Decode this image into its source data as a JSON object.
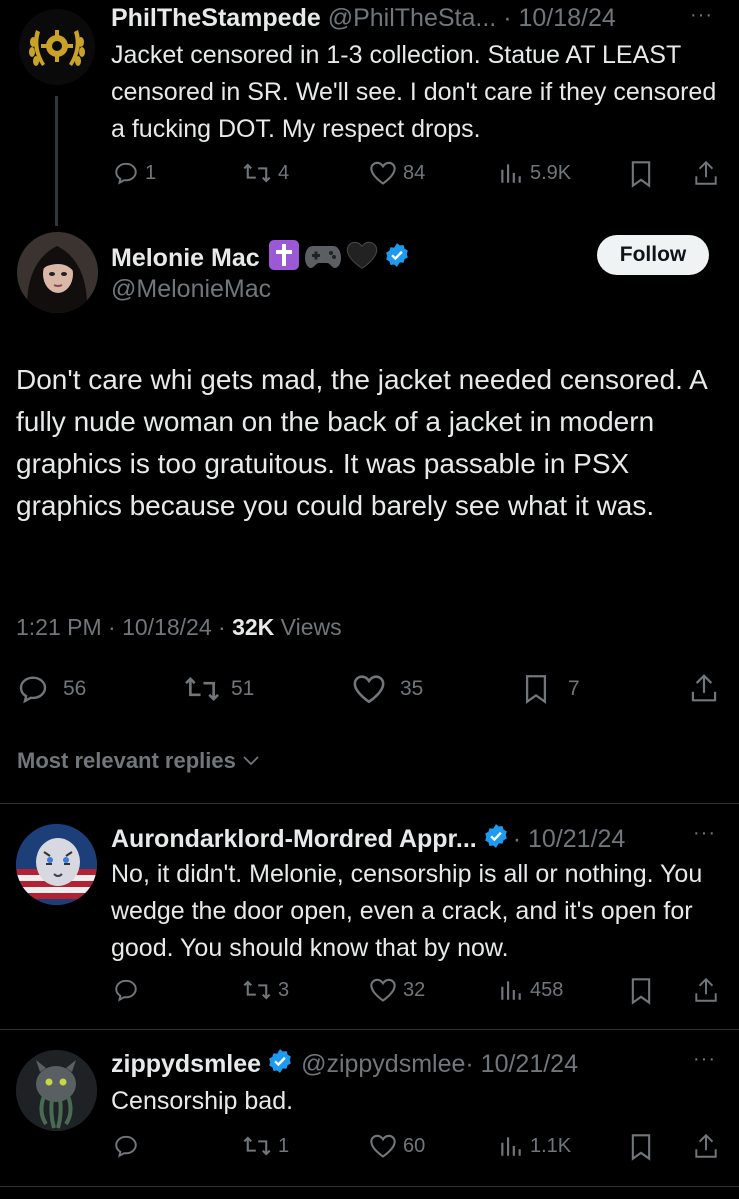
{
  "tweet1": {
    "display_name": "PhilTheStampede",
    "handle": "@PhilTheSta...",
    "date": "· 10/18/24",
    "more": "···",
    "text": "Jacket censored in 1-3 collection. Statue AT LEAST censored in SR. We'll see. I don't care if they censored a fucking DOT. My respect drops.",
    "replies": "1",
    "retweets": "4",
    "likes": "84",
    "views": "5.9K"
  },
  "main": {
    "display_name": "Melonie Mac",
    "emojis": [
      "cross-emoji",
      "gamepad-emoji",
      "black-heart-emoji"
    ],
    "handle": "@MelonieMac",
    "follow_label": "Follow",
    "text": "Don't care whi gets mad, the jacket needed censored. A fully nude woman on the back of a jacket in modern graphics is too gratuitous. It was passable in PSX graphics because you could barely see what it was.",
    "time": "1:21 PM · 10/18/24 · ",
    "views_count": "32K",
    "views_label": " Views",
    "replies": "56",
    "retweets": "51",
    "likes": "35",
    "bookmarks": "7"
  },
  "sort": {
    "label": "Most relevant replies"
  },
  "reply1": {
    "display_name": "Aurondarklord-Mordred Appr...",
    "date": "· 10/21/24",
    "more": "···",
    "text": "No, it didn't.  Melonie, censorship is all or nothing. You wedge the door open, even a crack, and it's open for good.  You should know that by now.",
    "replies": "",
    "retweets": "3",
    "likes": "32",
    "views": "458"
  },
  "reply2": {
    "display_name": "zippydsmlee",
    "handle": "@zippydsmlee",
    "date": "· 10/21/24",
    "more": "···",
    "text": "Censorship bad.",
    "replies": "",
    "retweets": "1",
    "likes": "60",
    "views": "1.1K"
  },
  "colors": {
    "background": "#000000",
    "text": "#e7e9ea",
    "secondary": "#71767b",
    "verified": "#1d9bf0",
    "divider": "#2f3336"
  }
}
